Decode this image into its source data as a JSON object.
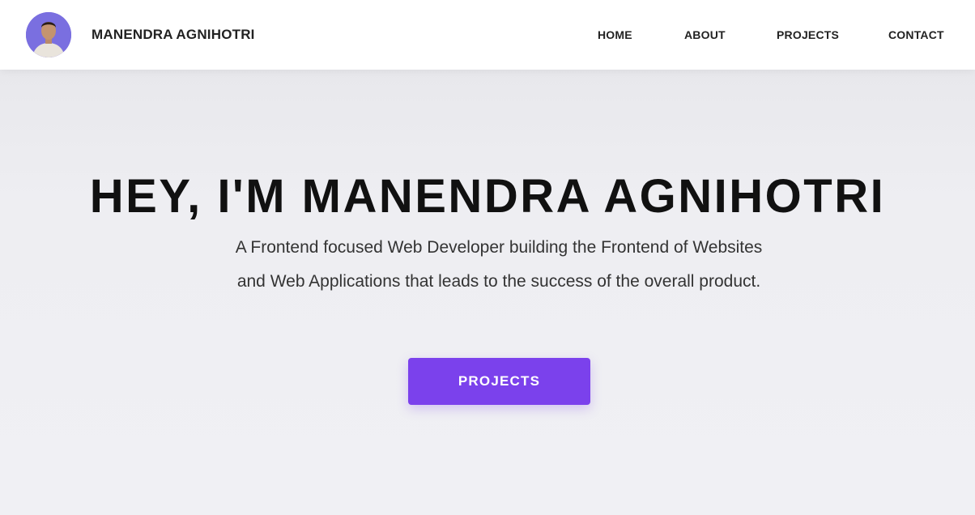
{
  "header": {
    "brand_name": "MANENDRA AGNIHOTRI",
    "avatar_icon": "profile-photo",
    "nav": {
      "home": "HOME",
      "about": "ABOUT",
      "projects": "PROJECTS",
      "contact": "CONTACT"
    }
  },
  "hero": {
    "title": "HEY, I'M MANENDRA AGNIHOTRI",
    "subtitle": "A Frontend focused Web Developer building the Frontend of Websites and Web Applications that leads to the success of the overall product.",
    "cta_label": "PROJECTS"
  },
  "colors": {
    "accent": "#7b41ec",
    "header_bg": "#ffffff",
    "hero_bg": "#f0f0f4",
    "text_dark": "#111111"
  }
}
